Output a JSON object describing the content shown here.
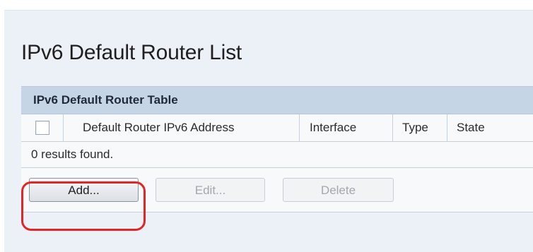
{
  "page": {
    "title": "IPv6 Default Router List"
  },
  "table": {
    "caption": "IPv6 Default Router Table",
    "columns": [
      "Default Router IPv6 Address",
      "Interface",
      "Type",
      "State"
    ],
    "results_text": "0 results found."
  },
  "actions": {
    "add_label": "Add...",
    "edit_label": "Edit...",
    "delete_label": "Delete"
  },
  "colors": {
    "caption_bg": "#c6d5e6",
    "panel_bg": "#ecf1f7",
    "highlight": "#e42525"
  }
}
